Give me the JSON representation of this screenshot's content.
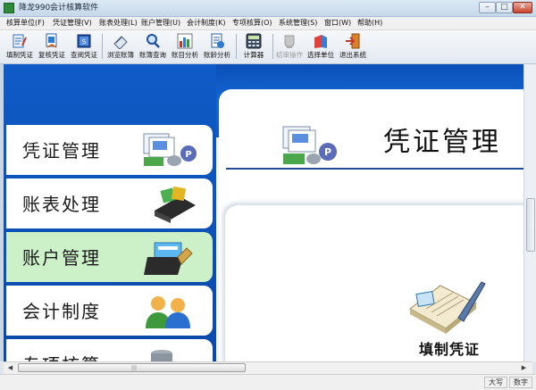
{
  "window": {
    "title": "降龙990会计核算软件",
    "controls": {
      "minimize": "–",
      "maximize": "□",
      "close": "✕"
    }
  },
  "menu": [
    "核算单位(F)",
    "凭证管理(V)",
    "账表处理(L)",
    "账户管理(U)",
    "会计制度(K)",
    "专项核算(O)",
    "系统管理(S)",
    "窗口(W)",
    "帮助(H)"
  ],
  "toolbar": {
    "buttons": [
      {
        "label": "填制凭证",
        "icon": "voucher-fill-icon"
      },
      {
        "label": "复核凭证",
        "icon": "voucher-review-icon"
      },
      {
        "label": "查阅凭证",
        "icon": "voucher-lookup-icon"
      },
      {
        "label": "浏览账簿",
        "icon": "ledger-browse-icon"
      },
      {
        "label": "账簿查询",
        "icon": "ledger-search-icon"
      },
      {
        "label": "账目分析",
        "icon": "account-analysis-icon"
      },
      {
        "label": "账龄分析",
        "icon": "aging-analysis-icon"
      },
      {
        "label": "计算器",
        "icon": "calculator-icon"
      },
      {
        "label": "结审操作",
        "icon": "settle-icon",
        "disabled": true
      },
      {
        "label": "选择单位",
        "icon": "select-unit-icon"
      },
      {
        "label": "退出系统",
        "icon": "exit-icon"
      }
    ]
  },
  "nav": {
    "items": [
      {
        "label": "凭证管理",
        "icon": "voucher-stack-icon"
      },
      {
        "label": "账表处理",
        "icon": "ledger-box-icon"
      },
      {
        "label": "账户管理",
        "icon": "account-folder-icon",
        "active": true
      },
      {
        "label": "会计制度",
        "icon": "people-icon"
      },
      {
        "label": "专项核算",
        "icon": "special-icon"
      }
    ]
  },
  "content": {
    "title": "凭证管理",
    "functions": [
      {
        "label": "填制凭证",
        "icon": "voucher-book-pen-icon"
      }
    ]
  },
  "status": {
    "cells": [
      "大写",
      "数字"
    ]
  },
  "colors": {
    "band_blue": "#0f5bc7",
    "active_nav": "#ccf0c8",
    "header_line": "#1f4d98"
  }
}
